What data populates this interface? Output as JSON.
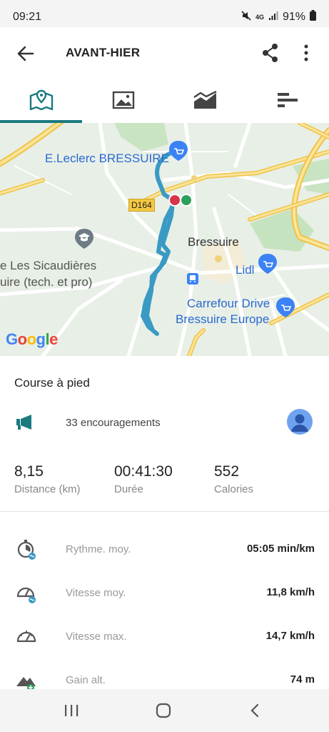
{
  "status": {
    "time": "09:21",
    "network": "4G",
    "battery": "91%"
  },
  "appbar": {
    "title": "AVANT-HIER"
  },
  "tabs": [
    {
      "name": "map",
      "icon": "map-pin-icon",
      "active": true
    },
    {
      "name": "photos",
      "icon": "image-icon",
      "active": false
    },
    {
      "name": "graphs",
      "icon": "chart-icon",
      "active": false
    },
    {
      "name": "stats",
      "icon": "bars-icon",
      "active": false
    }
  ],
  "map": {
    "labels": {
      "leclerc": "E.Leclerc BRESSUIRE",
      "road": "D164",
      "city": "Bressuire",
      "school_line1": "e Les Sicaudières",
      "school_line2": "uire (tech. et pro)",
      "lidl": "Lidl",
      "carrefour_line1": "Carrefour Drive",
      "carrefour_line2": "Bressuire Europe",
      "google": "Google"
    }
  },
  "activity": {
    "type": "Course à pied",
    "cheers": "33 encouragements"
  },
  "summary": {
    "distance": {
      "value": "8,15",
      "label": "Distance (km)"
    },
    "duration": {
      "value": "00:41:30",
      "label": "Durée"
    },
    "calories": {
      "value": "552",
      "label": "Calories"
    }
  },
  "metrics": [
    {
      "label": "Rythme. moy.",
      "value": "05:05 min/km",
      "icon": "pace-icon"
    },
    {
      "label": "Vitesse moy.",
      "value": "11,8 km/h",
      "icon": "speedometer-avg-icon"
    },
    {
      "label": "Vitesse max.",
      "value": "14,7 km/h",
      "icon": "speedometer-max-icon"
    },
    {
      "label": "Gain alt.",
      "value": "74 m",
      "icon": "elevation-gain-icon"
    }
  ],
  "colors": {
    "accent": "#1a7a80",
    "route": "#3a9ac4",
    "start": "#2e9e5b",
    "end": "#d9344a"
  }
}
